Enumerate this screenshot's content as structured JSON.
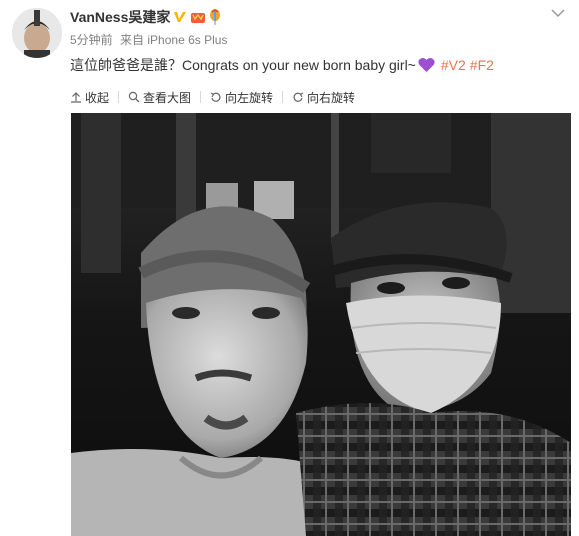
{
  "post": {
    "username": "VanNess吳建家",
    "time": "5分钟前",
    "via_prefix": "来自",
    "device": "iPhone 6s Plus",
    "text": "這位帥爸爸是誰？Congrats on your new born baby girl~",
    "tags": [
      "#V2",
      "#F2"
    ]
  },
  "toolbar": {
    "collapse_label": "收起",
    "view_large_label": "查看大图",
    "rotate_left_label": "向左旋转",
    "rotate_right_label": "向右旋转"
  },
  "icons": {
    "verified": "verified-v-icon",
    "vip": "vip-crown-icon",
    "balloon": "balloon-icon",
    "heart": "purple-heart-emoji",
    "chevron": "chevron-down-icon",
    "collapse": "arrow-up-icon",
    "zoom": "magnifier-icon",
    "rotate_left": "rotate-left-icon",
    "rotate_right": "rotate-right-icon"
  },
  "colors": {
    "tag": "#eb7350",
    "verified": "#f7b500",
    "heart": "#9b4fd1",
    "meta": "#808080"
  }
}
